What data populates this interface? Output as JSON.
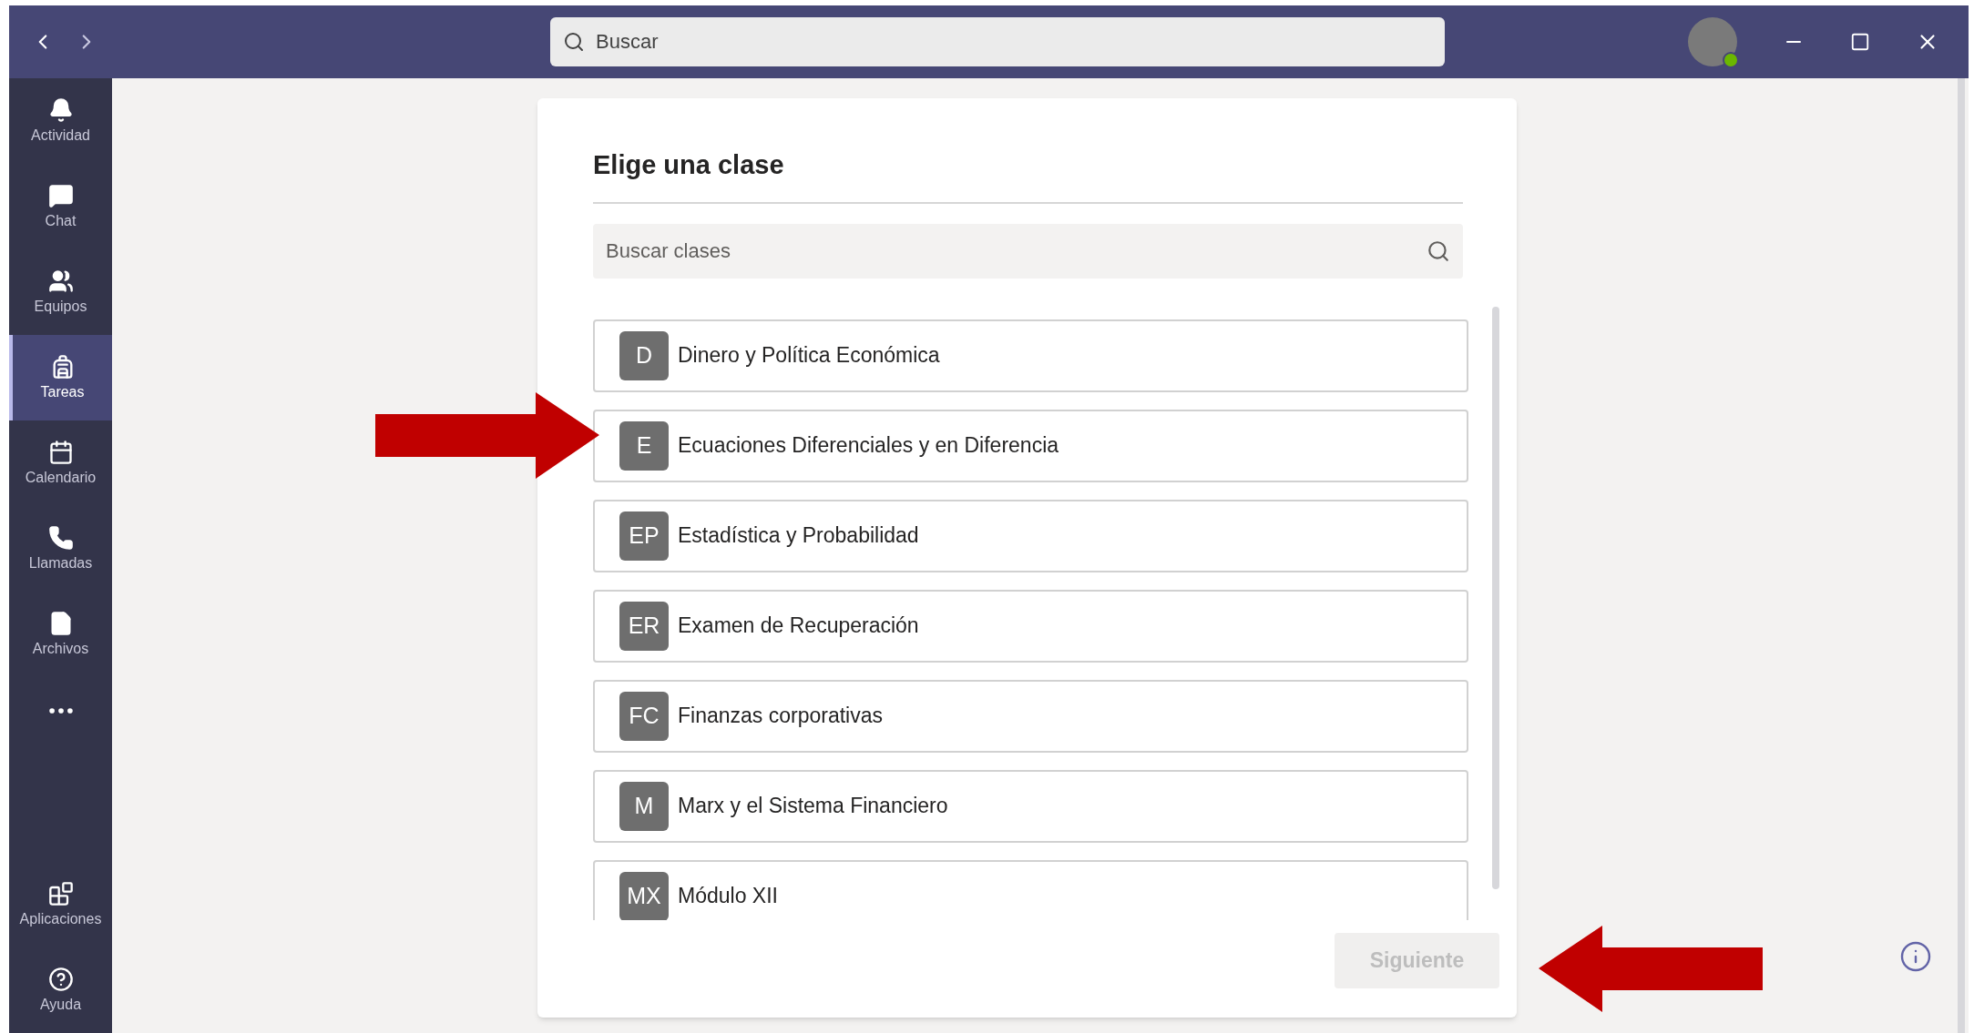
{
  "titlebar": {
    "search": {
      "placeholder": "Buscar"
    },
    "user": {
      "online": true
    }
  },
  "sidebar": {
    "items": [
      {
        "label": "Actividad",
        "selected": false
      },
      {
        "label": "Chat",
        "selected": false
      },
      {
        "label": "Equipos",
        "selected": false
      },
      {
        "label": "Tareas",
        "selected": true
      },
      {
        "label": "Calendario",
        "selected": false
      },
      {
        "label": "Llamadas",
        "selected": false
      },
      {
        "label": "Archivos",
        "selected": false
      }
    ],
    "bottom_items": [
      {
        "label": "Aplicaciones",
        "selected": false
      },
      {
        "label": "Ayuda",
        "selected": false
      }
    ]
  },
  "dialog": {
    "title": "Elige una clase",
    "search": {
      "placeholder": "Buscar clases"
    },
    "classes": [
      {
        "initials": "D",
        "name": "Dinero y Política Económica"
      },
      {
        "initials": "E",
        "name": "Ecuaciones Diferenciales y en Diferencia"
      },
      {
        "initials": "EP",
        "name": "Estadística y Probabilidad"
      },
      {
        "initials": "ER",
        "name": "Examen de Recuperación"
      },
      {
        "initials": "FC",
        "name": "Finanzas corporativas"
      },
      {
        "initials": "M",
        "name": "Marx y el Sistema Financiero"
      },
      {
        "initials": "MX",
        "name": "Módulo XII"
      }
    ],
    "next_button": {
      "label": "Siguiente",
      "disabled": true
    }
  }
}
